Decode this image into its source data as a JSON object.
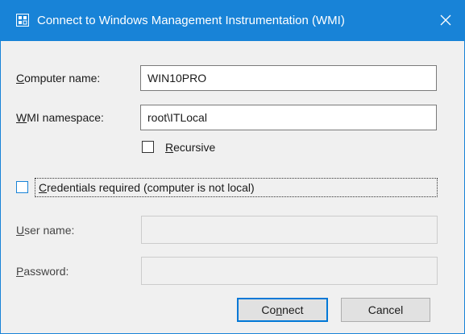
{
  "window": {
    "title": "Connect to Windows Management Instrumentation (WMI)",
    "accent_color": "#1883d7"
  },
  "computer_name": {
    "label_pre": "",
    "label_key": "C",
    "label_post": "omputer name:",
    "value": "WIN10PRO"
  },
  "wmi_namespace": {
    "label_pre": "",
    "label_key": "W",
    "label_post": "MI namespace:",
    "value": "root\\ITLocal"
  },
  "recursive": {
    "label_pre": "",
    "label_key": "R",
    "label_post": "ecursive",
    "checked": false
  },
  "credentials": {
    "label_pre": "",
    "label_key": "C",
    "label_post": "redentials required (computer is not local)",
    "checked": false
  },
  "user_name": {
    "label_pre": "",
    "label_key": "U",
    "label_post": "ser name:",
    "value": ""
  },
  "password": {
    "label_pre": "",
    "label_key": "P",
    "label_post": "assword:",
    "value": ""
  },
  "buttons": {
    "connect_pre": "Co",
    "connect_key": "n",
    "connect_post": "nect",
    "cancel": "Cancel"
  },
  "icons": {
    "app": "wmi-app-icon",
    "close": "close-icon"
  }
}
